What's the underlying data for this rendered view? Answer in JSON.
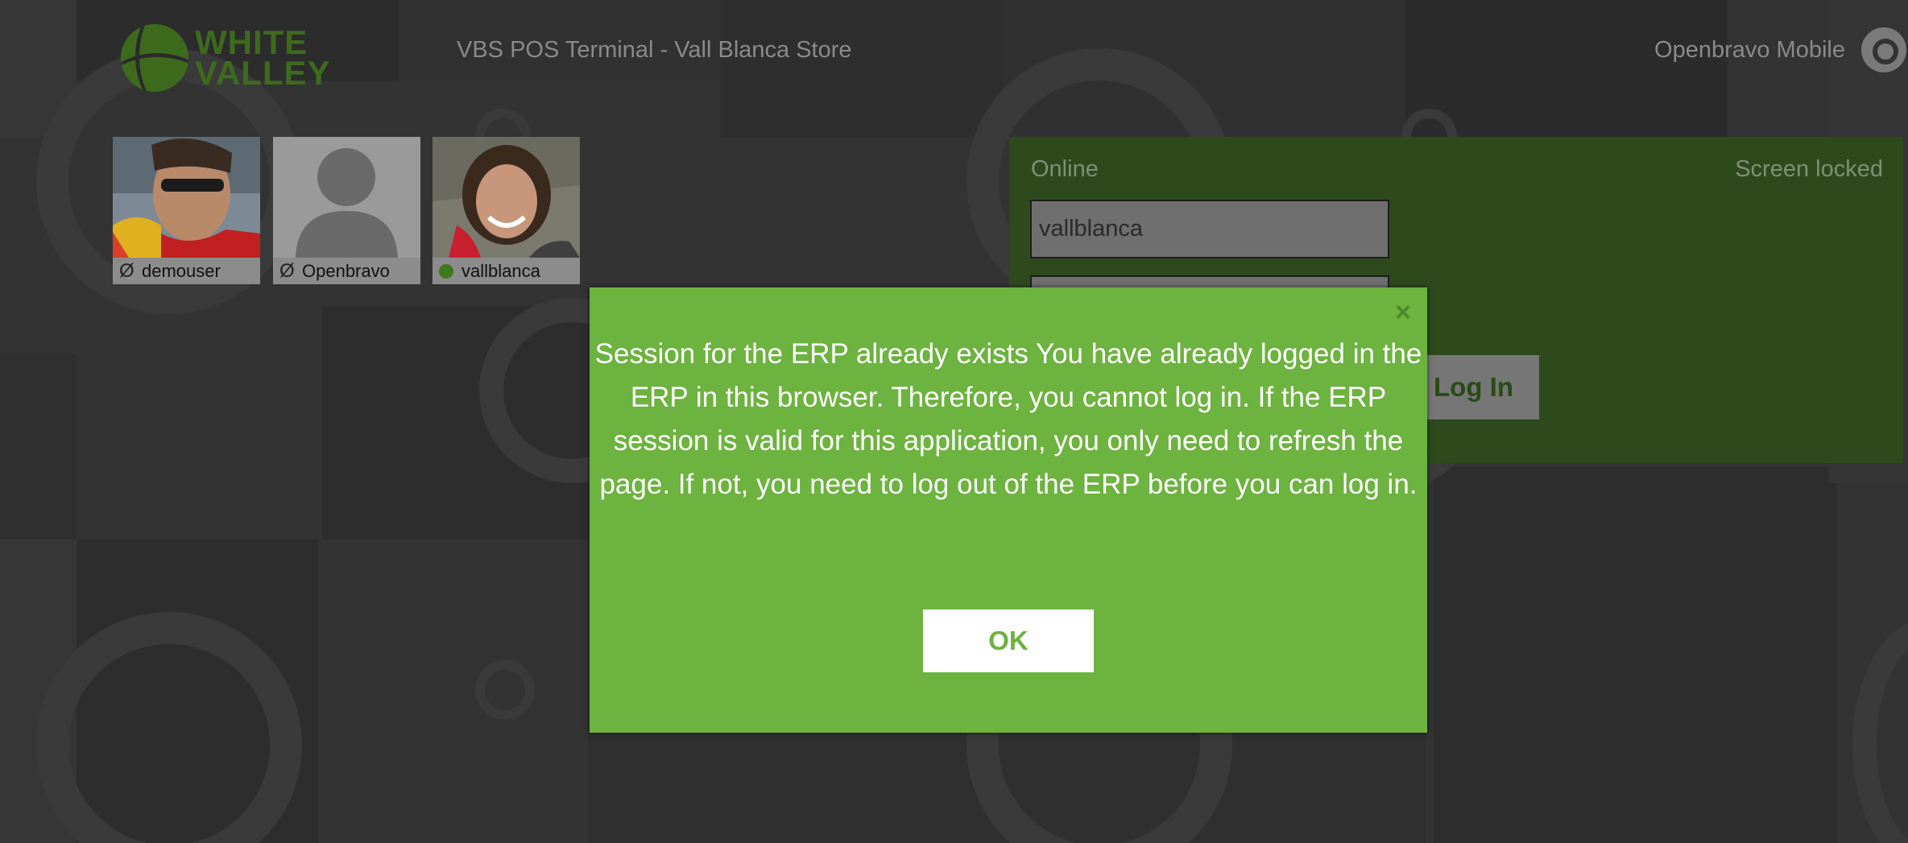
{
  "header": {
    "brand_line1": "WHITE",
    "brand_line2": "VALLEY",
    "terminal_title": "VBS POS Terminal - Vall Blanca Store",
    "app_name": "Openbravo Mobile"
  },
  "users": [
    {
      "name": "demouser",
      "status": "offline",
      "status_glyph": "Ø"
    },
    {
      "name": "Openbravo",
      "status": "offline",
      "status_glyph": "Ø"
    },
    {
      "name": "vallblanca",
      "status": "online"
    }
  ],
  "login_panel": {
    "connection_status": "Online",
    "lock_status": "Screen locked",
    "username_value": "vallblanca",
    "login_button": "Log In"
  },
  "dialog": {
    "close_glyph": "×",
    "message": "Session for the ERP already exists You have already logged in the ERP in this browser. Therefore, you cannot log in. If the ERP session is valid for this application, you only need to refresh the page. If not, you need to log out of the ERP before you can log in.",
    "ok_button": "OK"
  },
  "colors": {
    "accent": "#6db33f",
    "background": "#333333"
  }
}
